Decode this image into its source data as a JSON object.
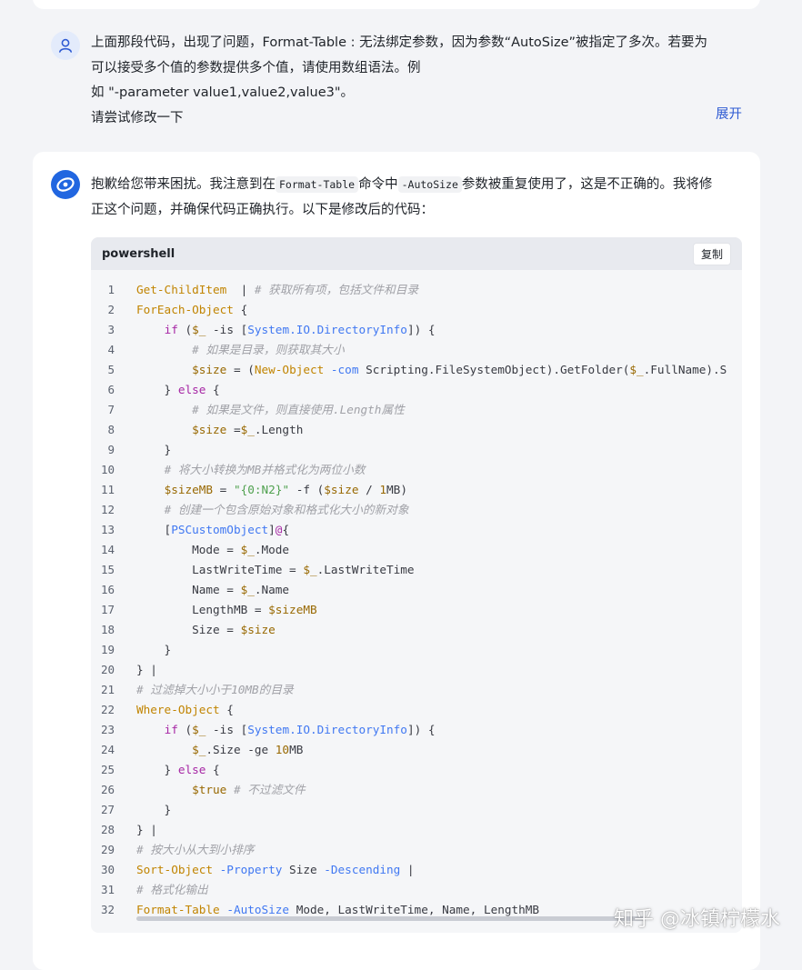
{
  "user_message": {
    "lines": [
      "上面那段代码，出现了问题，Format-Table : 无法绑定参数，因为参数“AutoSize”被指定了多次。若要为",
      "可以接受多个值的参数提供多个值，请使用数组语法。例",
      "如 \"-parameter value1,value2,value3\"。",
      "请尝试修改一下"
    ],
    "expand_label": "展开"
  },
  "ai_message": {
    "intro_part1": "抱歉给您带来困扰。我注意到在",
    "intro_code1": "Format-Table",
    "intro_part2": "命令中",
    "intro_code2": "-AutoSize",
    "intro_part3": "参数被重复使用了，这是不正确的。我将修",
    "intro_line2": "正这个问题，并确保代码正确执行。以下是修改后的代码：",
    "code": {
      "language": "powershell",
      "copy_label": "复制",
      "lines": [
        [
          [
            "cmd",
            "Get-ChildItem"
          ],
          [
            "",
            "  | "
          ],
          [
            "cm",
            "# 获取所有项，包括文件和目录"
          ]
        ],
        [
          [
            "cmd",
            "ForEach-Object"
          ],
          [
            "",
            " {"
          ]
        ],
        [
          [
            "",
            "    "
          ],
          [
            "kw",
            "if"
          ],
          [
            "",
            " ("
          ],
          [
            "var",
            "$_"
          ],
          [
            "",
            " -is ["
          ],
          [
            "typ",
            "System.IO.DirectoryInfo"
          ],
          [
            "",
            "]) {"
          ]
        ],
        [
          [
            "",
            "        "
          ],
          [
            "cm",
            "# 如果是目录，则获取其大小"
          ]
        ],
        [
          [
            "",
            "        "
          ],
          [
            "var",
            "$size"
          ],
          [
            "",
            " = ("
          ],
          [
            "cmd",
            "New-Object"
          ],
          [
            "",
            " "
          ],
          [
            "par",
            "-com"
          ],
          [
            "",
            " Scripting.FileSystemObject).GetFolder("
          ],
          [
            "var",
            "$_"
          ],
          [
            "",
            ".FullName).S"
          ]
        ],
        [
          [
            "",
            "    } "
          ],
          [
            "kw",
            "else"
          ],
          [
            "",
            " {"
          ]
        ],
        [
          [
            "",
            "        "
          ],
          [
            "cm",
            "# 如果是文件，则直接使用.Length属性"
          ]
        ],
        [
          [
            "",
            "        "
          ],
          [
            "var",
            "$size"
          ],
          [
            "",
            " ="
          ],
          [
            "var",
            "$_"
          ],
          [
            "",
            ".Length"
          ]
        ],
        [
          [
            "",
            "    }"
          ]
        ],
        [
          [
            "",
            "    "
          ],
          [
            "cm",
            "# 将大小转换为MB并格式化为两位小数"
          ]
        ],
        [
          [
            "",
            "    "
          ],
          [
            "var",
            "$sizeMB"
          ],
          [
            "",
            " = "
          ],
          [
            "str",
            "\"{0:N2}\""
          ],
          [
            "",
            " -f ("
          ],
          [
            "var",
            "$size"
          ],
          [
            "",
            " / "
          ],
          [
            "num",
            "1"
          ],
          [
            "",
            "MB)"
          ]
        ],
        [
          [
            "",
            "    "
          ],
          [
            "cm",
            "# 创建一个包含原始对象和格式化大小的新对象"
          ]
        ],
        [
          [
            "",
            "    ["
          ],
          [
            "typ",
            "PSCustomObject"
          ],
          [
            "",
            "]"
          ],
          [
            "kw",
            "@"
          ],
          [
            "",
            "{"
          ]
        ],
        [
          [
            "",
            "        Mode = "
          ],
          [
            "var",
            "$_"
          ],
          [
            "",
            ".Mode"
          ]
        ],
        [
          [
            "",
            "        LastWriteTime = "
          ],
          [
            "var",
            "$_"
          ],
          [
            "",
            ".LastWriteTime"
          ]
        ],
        [
          [
            "",
            "        Name = "
          ],
          [
            "var",
            "$_"
          ],
          [
            "",
            ".Name"
          ]
        ],
        [
          [
            "",
            "        LengthMB = "
          ],
          [
            "var",
            "$sizeMB"
          ]
        ],
        [
          [
            "",
            "        Size = "
          ],
          [
            "var",
            "$size"
          ]
        ],
        [
          [
            "",
            "    }"
          ]
        ],
        [
          [
            "",
            "} |"
          ]
        ],
        [
          [
            "cm",
            "# 过滤掉大小小于10MB的目录"
          ]
        ],
        [
          [
            "cmd",
            "Where-Object"
          ],
          [
            "",
            " {"
          ]
        ],
        [
          [
            "",
            "    "
          ],
          [
            "kw",
            "if"
          ],
          [
            "",
            " ("
          ],
          [
            "var",
            "$_"
          ],
          [
            "",
            " -is ["
          ],
          [
            "typ",
            "System.IO.DirectoryInfo"
          ],
          [
            "",
            "]) {"
          ]
        ],
        [
          [
            "",
            "        "
          ],
          [
            "var",
            "$_"
          ],
          [
            "",
            ".Size -ge "
          ],
          [
            "num",
            "10"
          ],
          [
            "",
            "MB"
          ]
        ],
        [
          [
            "",
            "    } "
          ],
          [
            "kw",
            "else"
          ],
          [
            "",
            " {"
          ]
        ],
        [
          [
            "",
            "        "
          ],
          [
            "var",
            "$true"
          ],
          [
            "",
            " "
          ],
          [
            "cm",
            "# 不过滤文件"
          ]
        ],
        [
          [
            "",
            "    }"
          ]
        ],
        [
          [
            "",
            "} |"
          ]
        ],
        [
          [
            "cm",
            "# 按大小从大到小排序"
          ]
        ],
        [
          [
            "cmd",
            "Sort-Object"
          ],
          [
            "",
            " "
          ],
          [
            "par",
            "-Property"
          ],
          [
            "",
            " Size "
          ],
          [
            "par",
            "-Descending"
          ],
          [
            "",
            " |"
          ]
        ],
        [
          [
            "cm",
            "# 格式化输出"
          ]
        ],
        [
          [
            "cmd",
            "Format-Table"
          ],
          [
            "",
            " "
          ],
          [
            "par",
            "-AutoSize"
          ],
          [
            "",
            " Mode, LastWriteTime, Name, LengthMB"
          ]
        ]
      ]
    }
  },
  "watermark": "知乎 @冰镇柠檬水",
  "colors": {
    "background": "#f3f4f7",
    "card": "#ffffff",
    "code_bg": "#f5f6f8",
    "code_header": "#e8eaef",
    "link": "#2f5bd3",
    "ai_avatar": "#2166e0"
  }
}
